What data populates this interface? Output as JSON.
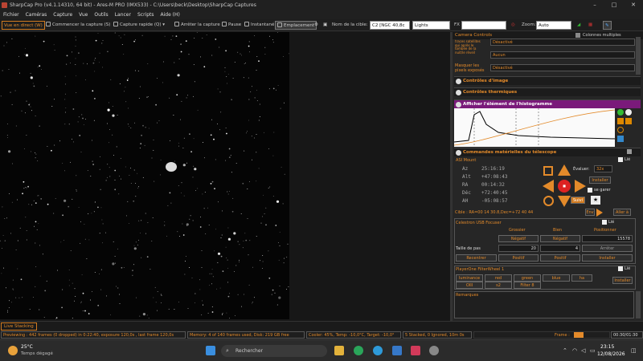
{
  "window": {
    "title": "SharpCap Pro (v4.1.14310, 64 bit) - Ares-M PRO (IMX533) - C:\\Users\\beck\\Desktop\\SharpCap Captures"
  },
  "menu": [
    "Fichier",
    "Caméras",
    "Capture",
    "Vue",
    "Outils",
    "Lancer",
    "Scripts",
    "Aide (H)"
  ],
  "toolbar": {
    "live": "Vue en direct (W)",
    "start": "Commencer la capture (S)",
    "quick": "Capture rapide (Q)",
    "stop": "Arrêter la capture",
    "pause": "Pause",
    "snapshot": "Instantané",
    "location": "Emplacement",
    "target_label": "Nom de la cible:",
    "target_value": "C2 [NGC 40,8c",
    "frame_type": "Lights",
    "fx": "FX",
    "zoom_label": "Zoom:",
    "zoom_value": "Auto"
  },
  "panel": {
    "title": "Camera Controls",
    "multi_col": "Colonnes multiples",
    "row1_label": "traces satellites\nqui après le\ntombée de la\nnuit/le réveil",
    "row1_value": "Désactivé",
    "row2_value": "Aucun",
    "row3_label": "Masquer les\npixels exposés",
    "row3_value": "Désactivé",
    "sec_image": "Contrôles d'image",
    "sec_thermal": "Contrôles thermiques",
    "sec_histo": "Afficher l'élément de l'histogramme",
    "sec_tele": "Commandes matérielles du télescope",
    "mount": {
      "name": "ASI Mount",
      "linked": "Lié",
      "eval_label": "Évaluer:",
      "eval_value": "32x",
      "install": "Installer",
      "park": "se garer",
      "follow": "Suivi",
      "coords": [
        {
          "k": "Az",
          "v": "25:16:19"
        },
        {
          "k": "Alt",
          "v": "+47:08:43"
        },
        {
          "k": "RA",
          "v": "00:14:32"
        },
        {
          "k": "Déc",
          "v": "+72:40:45"
        },
        {
          "k": "AH",
          "v": "-05:08:57"
        }
      ],
      "target": "Cible : RA=00 14 30.8,Dec=+72 40 44",
      "goto": "Aller à",
      "env": "Env"
    },
    "focuser": {
      "name": "Celestron USB Focuser",
      "linked": "Lié",
      "col1": "Grossier",
      "col2": "Bien",
      "col3": "Positionner",
      "neg1": "Négatif",
      "neg2": "Négatif",
      "position": "15578",
      "step_label": "Taille de pas",
      "step1": "20",
      "step2": "4",
      "stop": "Arrêter",
      "recenter": "Recentrer",
      "pos1": "Positif",
      "pos2": "Positif",
      "install": "Installer"
    },
    "wheel": {
      "name": "PlayerOne FilterWheel 1",
      "linked": "Lié",
      "filters": [
        "luminance",
        "red",
        "green",
        "blue",
        "ha",
        "OIII",
        "s2",
        "Filter 8"
      ],
      "install": "Installer"
    },
    "remarks": "Remarques"
  },
  "live_stack": "Live Stacking",
  "status": {
    "previewing": "Previewing : 442 frames (0 dropped) in 0:22:40, exposure 120,0s , last frame 120,0s",
    "memory": "Memory: 4 of 140 frames used, Disk: 219 GB free",
    "cooler": "Cooler: 45%, Temp: -10,0°C, Target: -10,0°",
    "stacked": "5 Stacked, 0 Ignored, 10m 0s",
    "frame_label": "Frame :",
    "timer": "00:30/01:30"
  },
  "taskbar": {
    "temp": "25°C",
    "weather": "Temps dégagé",
    "search": "Rechercher",
    "time": "23:15",
    "date": "12/08/2026"
  },
  "colors": {
    "accent": "#e38a2a",
    "histo": "#7a1a7a"
  }
}
